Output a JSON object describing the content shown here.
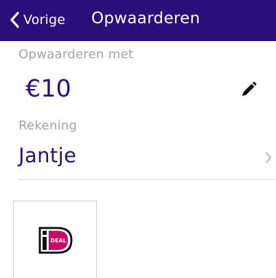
{
  "header": {
    "back_label": "Vorige",
    "title": "Opwaarderen",
    "background_color": "#2a0f7a"
  },
  "amount": {
    "label": "Opwaarderen met",
    "value": "€10",
    "edit_icon": "pencil-icon"
  },
  "account": {
    "label": "Rekening",
    "value": "Jantje",
    "chevron_icon": "chevron-right-icon"
  },
  "payment_methods": [
    {
      "name": "iDEAL",
      "logo_text": "iDEAL",
      "logo_color": "#cc0066"
    }
  ],
  "colors": {
    "accent": "#2a0f7a",
    "label": "#a3a3a3",
    "divider": "#d6d6d6"
  }
}
